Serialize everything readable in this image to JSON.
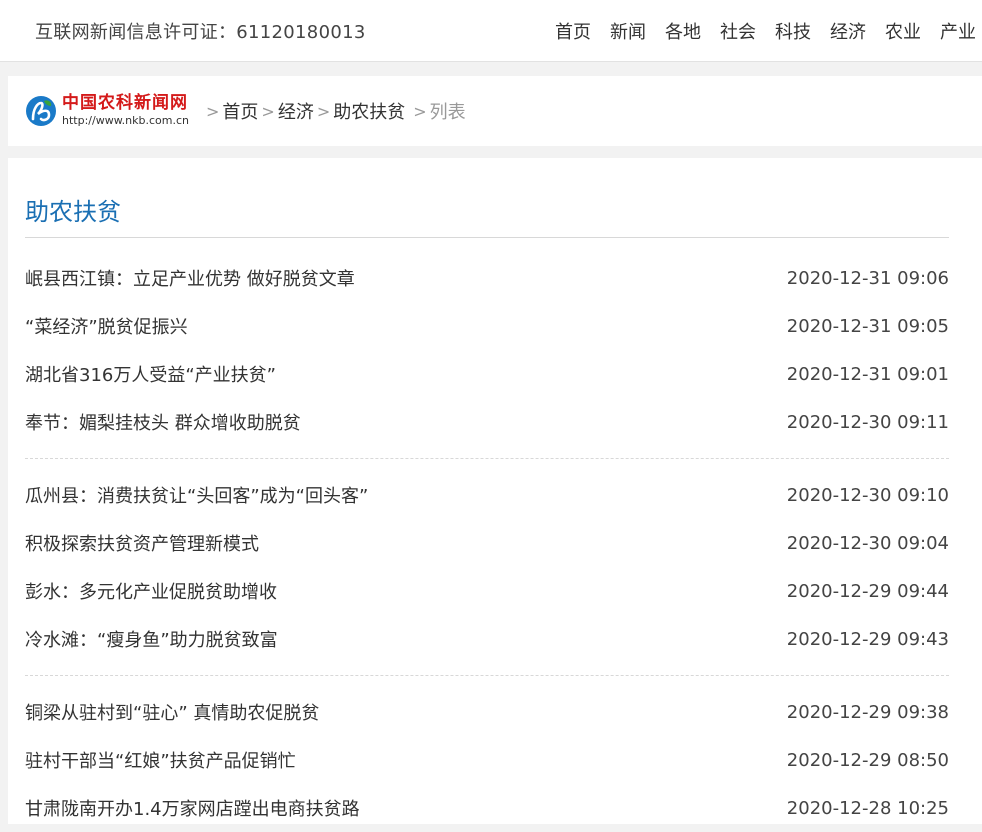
{
  "topbar": {
    "license": "互联网新闻信息许可证：61120180013",
    "nav": [
      "首页",
      "新闻",
      "各地",
      "社会",
      "科技",
      "经济",
      "农业",
      "产业"
    ]
  },
  "logo": {
    "title": "中国农科新闻网",
    "url": "http://www.nkb.com.cn"
  },
  "breadcrumb": {
    "home": "首页",
    "level1": "经济",
    "level2": "助农扶贫",
    "current": "列表",
    "separator": ">"
  },
  "section": {
    "title": "助农扶贫"
  },
  "articles": [
    [
      {
        "title": "岷县西江镇：立足产业优势 做好脱贫文章",
        "date": "2020-12-31 09:06"
      },
      {
        "title": "“菜经济”脱贫促振兴",
        "date": "2020-12-31 09:05"
      },
      {
        "title": "湖北省316万人受益“产业扶贫”",
        "date": "2020-12-31 09:01"
      },
      {
        "title": "奉节：媚梨挂枝头 群众增收助脱贫",
        "date": "2020-12-30 09:11"
      }
    ],
    [
      {
        "title": "瓜州县：消费扶贫让“头回客”成为“回头客”",
        "date": "2020-12-30 09:10"
      },
      {
        "title": "积极探索扶贫资产管理新模式",
        "date": "2020-12-30 09:04"
      },
      {
        "title": "彭水：多元化产业促脱贫助增收",
        "date": "2020-12-29 09:44"
      },
      {
        "title": "冷水滩：“瘦身鱼”助力脱贫致富",
        "date": "2020-12-29 09:43"
      }
    ],
    [
      {
        "title": "铜梁从驻村到“驻心” 真情助农促脱贫",
        "date": "2020-12-29 09:38"
      },
      {
        "title": "驻村干部当“红娘”扶贫产品促销忙",
        "date": "2020-12-29 08:50"
      },
      {
        "title": "甘肃陇南开办1.4万家网店蹚出电商扶贫路",
        "date": "2020-12-28 10:25"
      }
    ]
  ],
  "colors": {
    "accent": "#1a6fb3",
    "logo_red": "#d41a1a",
    "logo_blue": "#1a7ac8",
    "logo_green": "#3aa33a"
  }
}
